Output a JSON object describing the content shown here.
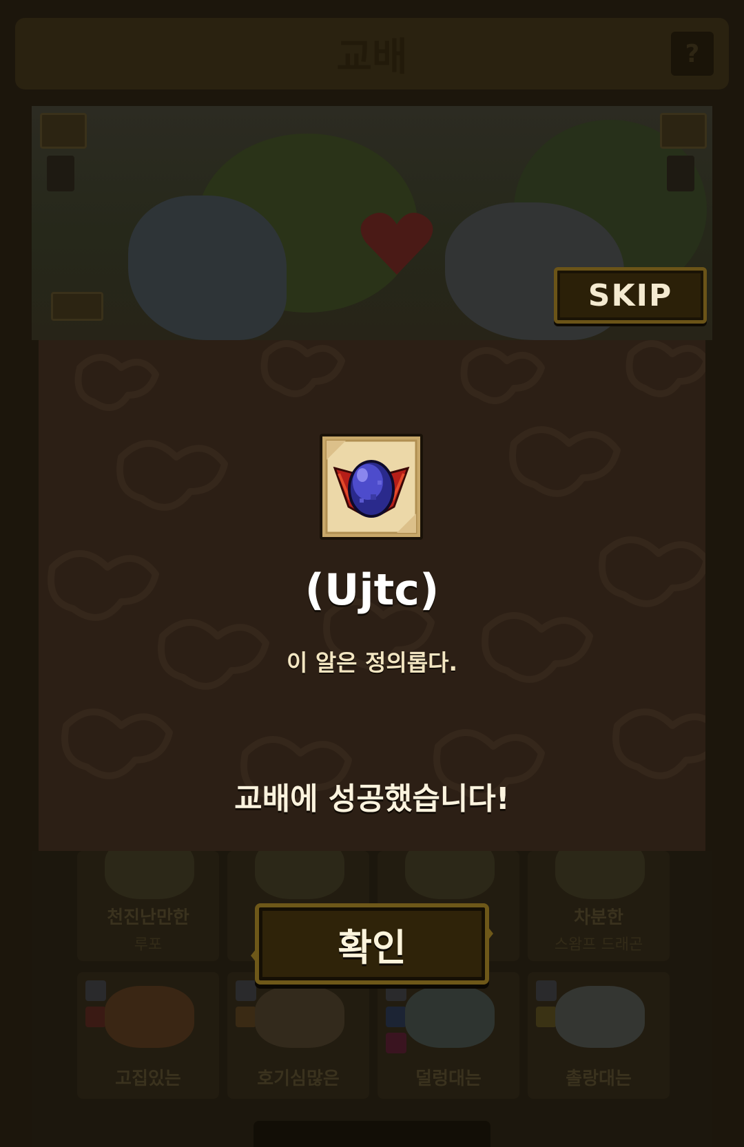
{
  "header": {
    "title": "교배",
    "help_label": "?"
  },
  "scene": {
    "skip_label": "SKIP"
  },
  "result": {
    "item_icon": "dragon-egg-icon",
    "item_name": "(Ujtc)",
    "item_description": "이 알은 정의롭다.",
    "message": "교배에 성공했습니다!",
    "confirm_label": "확인"
  },
  "grid": {
    "cards": [
      {
        "name": "천진난만한",
        "species": "루포"
      },
      {
        "name": "",
        "species": ""
      },
      {
        "name": "",
        "species": ""
      },
      {
        "name": "차분한",
        "species": "스왐프 드래곤"
      },
      {
        "name": "고집있는",
        "species": ""
      },
      {
        "name": "호기심많은",
        "species": ""
      },
      {
        "name": "덜렁대는",
        "species": ""
      },
      {
        "name": "촐랑대는",
        "species": ""
      }
    ]
  },
  "colors": {
    "modal_bg": "#2c1f15",
    "button_border": "#6e5819",
    "text_light": "#fbf3de"
  }
}
